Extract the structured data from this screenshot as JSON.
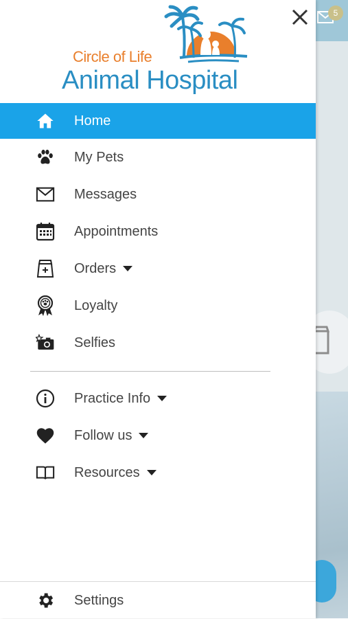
{
  "background": {
    "notification_count": "5",
    "accent_color": "#3ca7db"
  },
  "drawer": {
    "close_icon": "close-icon",
    "logo": {
      "line1": "Circle of Life",
      "line2": "Animal Hospital",
      "orange": "#e97f2c",
      "blue": "#2a8ec3"
    },
    "active_color": "#1aa3e8",
    "items": [
      {
        "label": "Home",
        "icon": "home-icon",
        "active": true
      },
      {
        "label": "My Pets",
        "icon": "paw-icon"
      },
      {
        "label": "Messages",
        "icon": "envelope-icon"
      },
      {
        "label": "Appointments",
        "icon": "calendar-icon"
      },
      {
        "label": "Orders",
        "icon": "pet-food-bag-icon",
        "dropdown": true
      },
      {
        "label": "Loyalty",
        "icon": "award-ribbon-icon"
      },
      {
        "label": "Selfies",
        "icon": "camera-star-icon"
      }
    ],
    "secondary_items": [
      {
        "label": "Practice Info",
        "icon": "info-icon",
        "dropdown": true
      },
      {
        "label": "Follow us",
        "icon": "heart-icon",
        "dropdown": true
      },
      {
        "label": "Resources",
        "icon": "book-icon",
        "dropdown": true
      }
    ],
    "footer": {
      "label": "Settings",
      "icon": "gear-icon"
    }
  }
}
